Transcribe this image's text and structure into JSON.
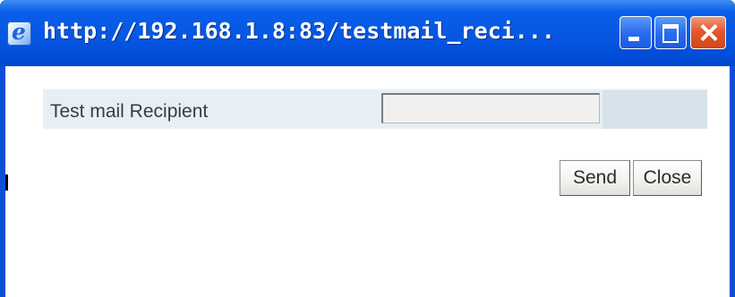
{
  "window": {
    "title": "http://192.168.1.8:83/testmail_reci...",
    "controls": {
      "minimize": "minimize-icon",
      "maximize": "maximize-icon",
      "close": "close-icon"
    }
  },
  "form": {
    "recipient_label": "Test mail Recipient",
    "recipient_value": ""
  },
  "actions": {
    "send_label": "Send",
    "close_label": "Close"
  },
  "colors": {
    "titlebar": "#0556e2",
    "close_button": "#d24618",
    "row_background": "#e8eff4"
  }
}
